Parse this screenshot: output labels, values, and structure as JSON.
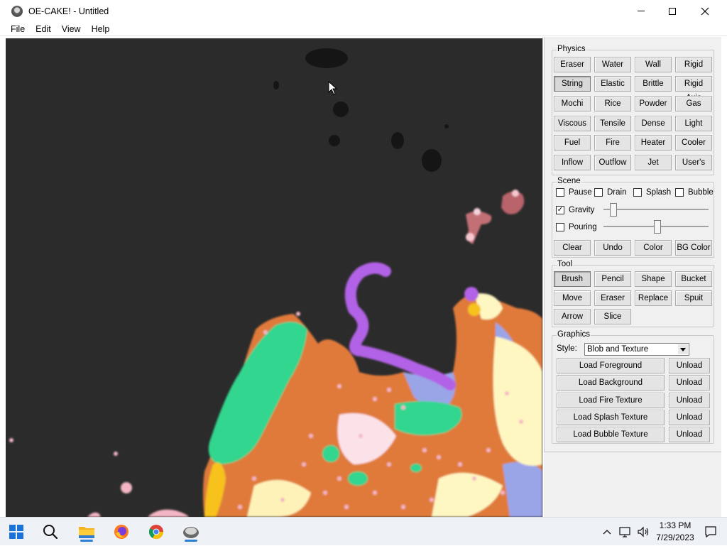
{
  "window": {
    "title": "OE-CAKE! - Untitled"
  },
  "menu": [
    "File",
    "Edit",
    "View",
    "Help"
  ],
  "physics": {
    "label": "Physics",
    "buttons": [
      "Eraser",
      "Water",
      "Wall",
      "Rigid",
      "String",
      "Elastic",
      "Brittle",
      "Rigid Axis",
      "Mochi",
      "Rice",
      "Powder",
      "Gas",
      "Viscous",
      "Tensile",
      "Dense",
      "Light",
      "Fuel",
      "Fire",
      "Heater",
      "Cooler",
      "Inflow",
      "Outflow",
      "Jet",
      "User's"
    ],
    "selected": "String"
  },
  "scene": {
    "label": "Scene",
    "checkboxes": [
      {
        "label": "Pause",
        "checked": false
      },
      {
        "label": "Drain",
        "checked": false
      },
      {
        "label": "Splash",
        "checked": false
      },
      {
        "label": "Bubble",
        "checked": false
      }
    ],
    "gravity": {
      "label": "Gravity",
      "checked": true,
      "level": 0.1
    },
    "pouring": {
      "label": "Pouring",
      "checked": false,
      "level": 0.55
    },
    "buttons": [
      "Clear",
      "Undo",
      "Color",
      "BG Color"
    ]
  },
  "tool": {
    "label": "Tool",
    "buttons": [
      "Brush",
      "Pencil",
      "Shape",
      "Bucket",
      "Move",
      "Eraser",
      "Replace",
      "Spuit",
      "Arrow",
      "Slice"
    ],
    "selected": "Brush"
  },
  "graphics": {
    "label": "Graphics",
    "style_label": "Style:",
    "style_value": "Blob and Texture",
    "loads": [
      {
        "load": "Load Foreground",
        "unload": "Unload"
      },
      {
        "load": "Load Background",
        "unload": "Unload"
      },
      {
        "load": "Load Fire Texture",
        "unload": "Unload"
      },
      {
        "load": "Load Splash Texture",
        "unload": "Unload"
      },
      {
        "load": "Load Bubble Texture",
        "unload": "Unload"
      }
    ]
  },
  "taskbar": {
    "icons": [
      "windows-start-icon",
      "search-icon",
      "file-explorer-icon",
      "firefox-icon",
      "chrome-icon",
      "oe-cake-icon"
    ],
    "time": "1:33 PM",
    "date": "7/29/2023"
  },
  "colors": {
    "canvas_bg": "#2b2b2b",
    "orange": "#e07a3a",
    "green": "#33d68f",
    "purple": "#b262e6",
    "pink": "#f4b6c4",
    "cream": "#fff7c2",
    "yellow": "#f7c21a"
  }
}
